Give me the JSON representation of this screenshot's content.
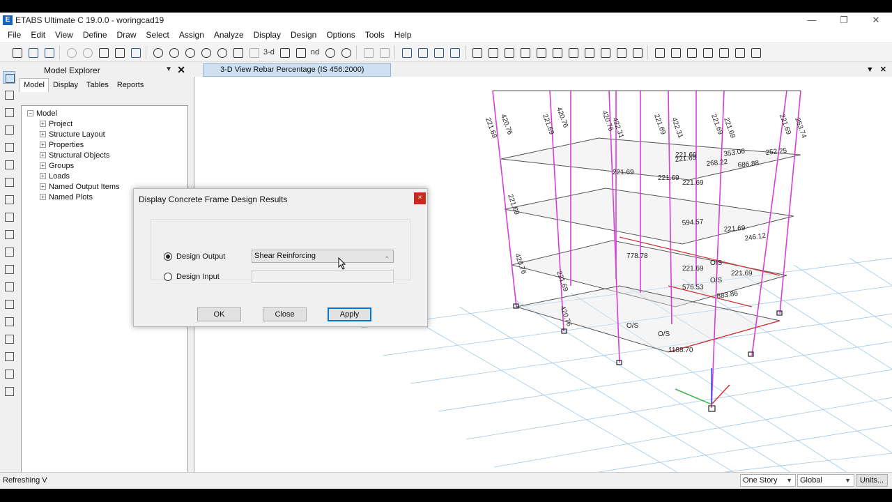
{
  "window": {
    "title": "ETABS Ultimate C 19.0.0 - woringcad19",
    "app_icon_letter": "E"
  },
  "menu": [
    "File",
    "Edit",
    "View",
    "Define",
    "Draw",
    "Select",
    "Assign",
    "Analyze",
    "Display",
    "Design",
    "Options",
    "Tools",
    "Help"
  ],
  "toolbar": {
    "view_3d_label": "3-d",
    "nd_label": "nd"
  },
  "explorer": {
    "title": "Model Explorer",
    "tabs": [
      "Model",
      "Display",
      "Tables",
      "Reports"
    ],
    "active_tab": "Model",
    "root": "Model",
    "items": [
      "Project",
      "Structure Layout",
      "Properties",
      "Structural Objects",
      "Groups",
      "Loads",
      "Named Output Items",
      "Named Plots"
    ]
  },
  "view": {
    "tab_title": "3-D View  Rebar Percentage  (IS 456:2000)"
  },
  "dialog": {
    "title": "Display Concrete Frame Design Results",
    "option_output": "Design Output",
    "option_input": "Design Input",
    "selected": "Design Output",
    "output_value": "Shear Reinforcing",
    "input_value": "",
    "ok_label": "OK",
    "close_label": "Close",
    "apply_label": "Apply",
    "close_icon": "×"
  },
  "status": {
    "text": "Refreshing V",
    "story_mode": "One Story",
    "coord_system": "Global",
    "units_label": "Units..."
  },
  "model_labels": [
    "221.69",
    "420.76",
    "221.69",
    "420.76",
    "420.76",
    "422.31",
    "221.69",
    "422.31",
    "221.69",
    "221.69",
    "221.69",
    "253.74",
    "221.69",
    "353.06",
    "252.25",
    "221.69",
    "268.22",
    "686.88",
    "221.69",
    "221.69",
    "221.69",
    "221.69",
    "594.57",
    "246.12",
    "778.78",
    "221.69",
    "O/S",
    "221.69",
    "O/S",
    "576.53",
    "883.86",
    "O/S",
    "O/S",
    "1188.70",
    "221.69",
    "420.76",
    "221.69",
    "420.76"
  ],
  "colors": {
    "column": "#d63fd6",
    "beam": "#555555",
    "red_beam": "#d32f2f",
    "grid": "#9ec8e8",
    "dialog_close": "#c42b1c",
    "view_tab": "#cfe0f3"
  },
  "icons": [
    "new-model-icon",
    "open-icon",
    "save-icon",
    "undo-icon",
    "redo-icon",
    "draw-icon",
    "lock-icon",
    "run-analysis-icon",
    "zoom-window-icon",
    "zoom-in-icon",
    "zoom-out-icon",
    "pan-icon",
    "3d-view-icon",
    "plan-view-icon",
    "elevation-view-icon",
    "rotate-icon",
    "move-up-icon",
    "move-down-icon",
    "display-options-icon",
    "check-icon",
    "axes-icon"
  ]
}
